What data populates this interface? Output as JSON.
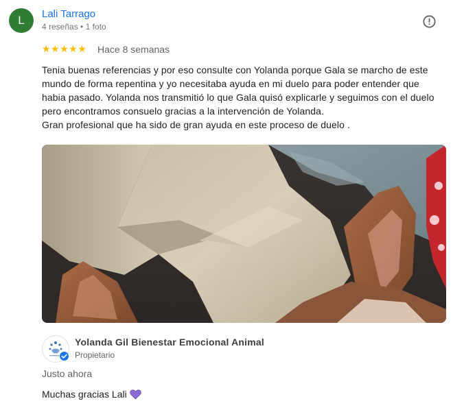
{
  "reviewer": {
    "initial": "L",
    "name": "Lali Tarrago",
    "meta": "4 reseñas • 1 foto",
    "avatar_color": "#2e7d32"
  },
  "review": {
    "stars": "★★★★★",
    "rating": 5,
    "time": "Hace 8 semanas",
    "paragraph1": "Tenia buenas referencias y por eso consulte con Yolanda porque Gala se marcho de este mundo de forma repentina y yo necesitaba ayuda en mi duelo para poder entender que habia pasado. Yolanda nos transmitió lo que Gala quisó explicarle y seguimos con el duelo pero encontramos consuelo gracias a la intervención de Yolanda.",
    "paragraph2": "Gran profesional que ha sido de gran ayuda en este proceso de duelo ."
  },
  "icons": {
    "report": "report-icon",
    "verified": "verified-badge-icon",
    "heart": "purple-heart-icon"
  },
  "owner_reply": {
    "name": "Yolanda Gil Bienestar Emocional Animal",
    "role": "Propietario",
    "time": "Justo ahora",
    "text": "Muchas gracias Lali"
  },
  "colors": {
    "name_link": "#1a73e8",
    "star": "#fbbc04",
    "verified": "#1a73e8",
    "heart": "#8e6bd8"
  }
}
